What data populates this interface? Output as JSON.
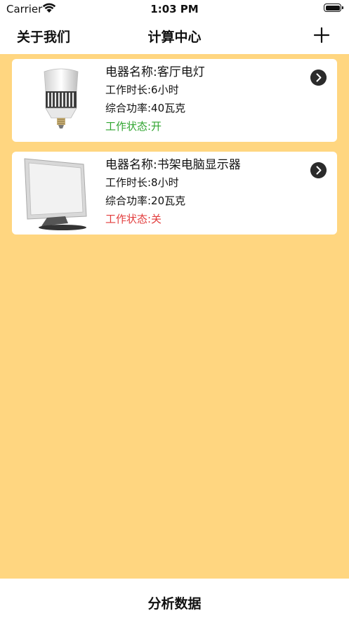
{
  "status_bar": {
    "carrier": "Carrier",
    "time": "1:03 PM"
  },
  "nav": {
    "left": "关于我们",
    "title": "计算中心",
    "right_icon": "plus-icon"
  },
  "devices": [
    {
      "name": "电器名称:客厅电灯",
      "hours": "工作时长:6小时",
      "power": "综合功率:40瓦克",
      "status": "工作状态:开",
      "status_color": "#2FA52F",
      "icon": "light-bulb-image"
    },
    {
      "name": "电器名称:书架电脑显示器",
      "hours": "工作时长:8小时",
      "power": "综合功率:20瓦克",
      "status": "工作状态:关",
      "status_color": "#E23B3B",
      "icon": "monitor-image"
    }
  ],
  "bottom": {
    "label": "分析数据"
  },
  "colors": {
    "background": "#FFD680",
    "card": "#FFFFFF",
    "on": "#2FA52F",
    "off": "#E23B3B"
  }
}
